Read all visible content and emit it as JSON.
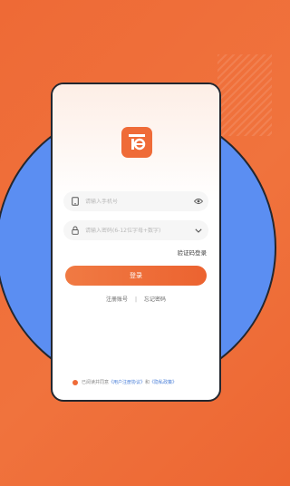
{
  "login": {
    "phone_placeholder": "请输入手机号",
    "password_placeholder": "请输入密码(6-12位字母+数字)",
    "code_login_label": "验证码登录",
    "login_button_label": "登录",
    "register_link": "注册账号",
    "separator": "|",
    "forgot_link": "忘记密码"
  },
  "agreement": {
    "prefix": "已阅读并同意",
    "user_agreement": "《用户注册协议》",
    "and": "和",
    "privacy_policy": "《隐私政策》"
  },
  "colors": {
    "background": "#ef6b38",
    "accent": "#ec6330",
    "circle": "#5b8ef2"
  }
}
